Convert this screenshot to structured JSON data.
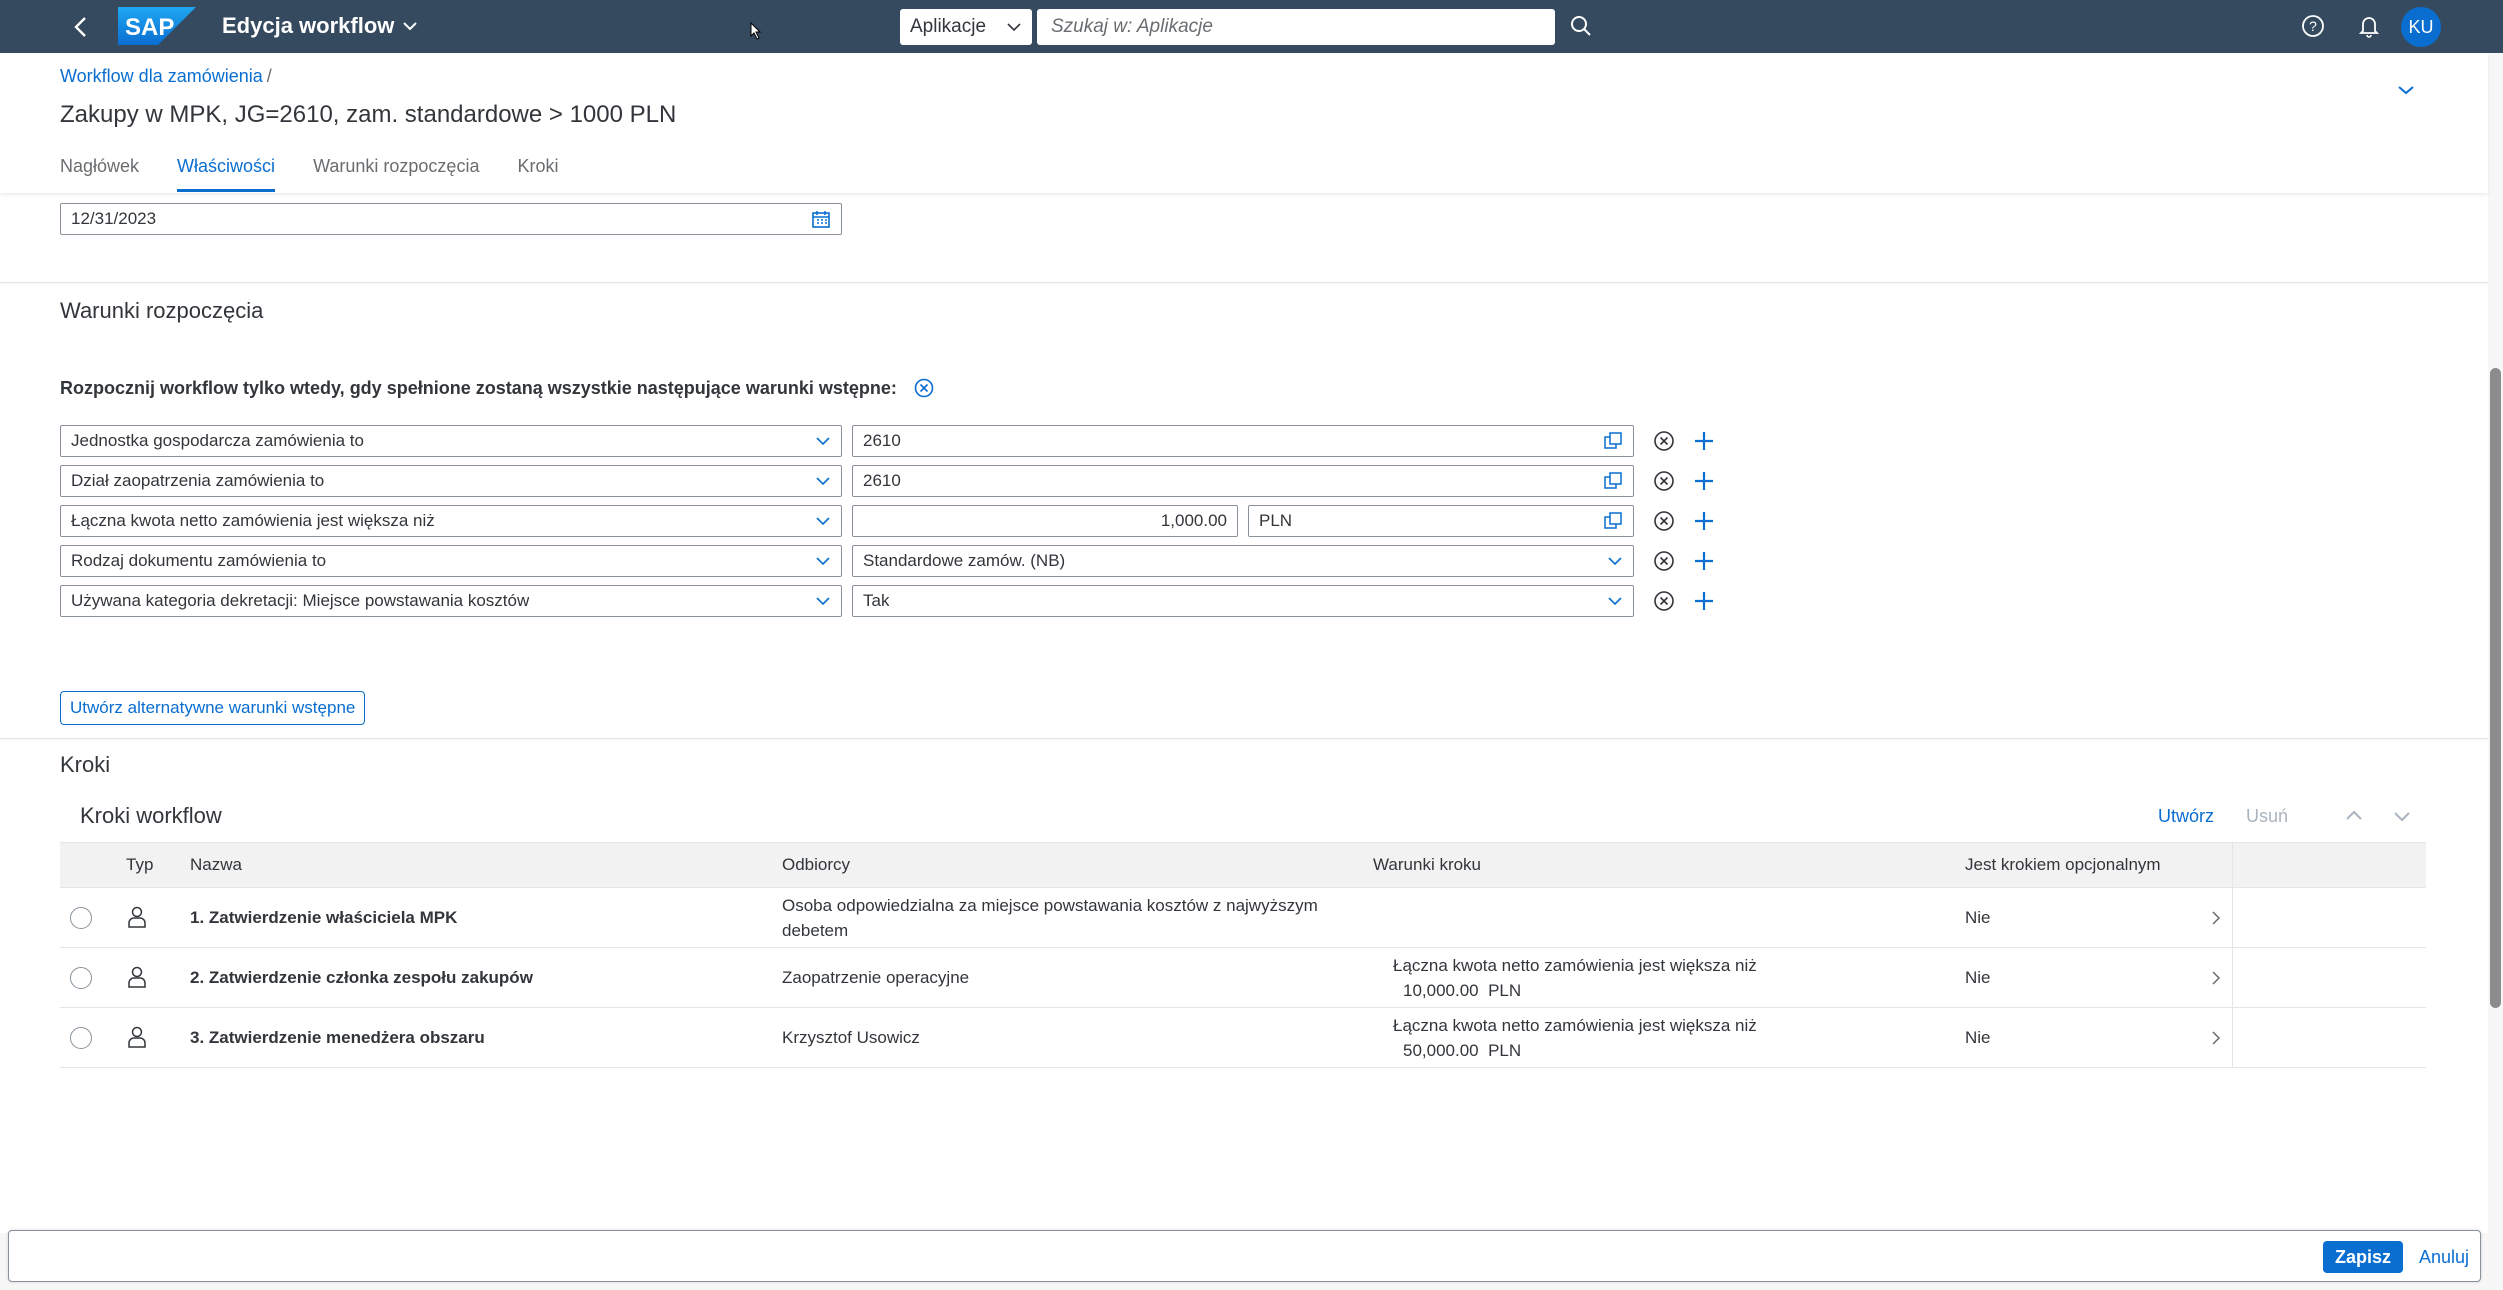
{
  "shell": {
    "app_title": "Edycja workflow",
    "scope": "Aplikacje",
    "search_placeholder": "Szukaj w: Aplikacje",
    "avatar": "KU",
    "logo_text": "SAP"
  },
  "header": {
    "breadcrumb": "Workflow dla zamówienia",
    "breadcrumb_sep": "/",
    "title": "Zakupy w MPK, JG=2610, zam. standardowe > 1000 PLN",
    "tabs": [
      "Nagłówek",
      "Właściwości",
      "Warunki rozpoczęcia",
      "Kroki"
    ],
    "active_tab": "Właściwości"
  },
  "properties": {
    "valid_to": "12/31/2023"
  },
  "start_conditions": {
    "title": "Warunki rozpoczęcia",
    "intro": "Rozpocznij workflow tylko wtedy, gdy spełnione zostaną wszystkie następujące warunki wstępne:",
    "rows": [
      {
        "condition": "Jednostka gospodarcza zamówienia to",
        "value": "2610"
      },
      {
        "condition": "Dział zaopatrzenia zamówienia to",
        "value": "2610"
      },
      {
        "condition": "Łączna kwota netto zamówienia jest większa niż",
        "amount": "1,000.00",
        "currency": "PLN"
      },
      {
        "condition": "Rodzaj dokumentu zamówienia to",
        "value": "Standardowe zamów. (NB)"
      },
      {
        "condition": "Używana kategoria dekretacji: Miejsce powstawania kosztów",
        "value": "Tak"
      }
    ],
    "alt_button": "Utwórz alternatywne warunki wstępne"
  },
  "steps": {
    "section_title": "Kroki",
    "table_title": "Kroki workflow",
    "create": "Utwórz",
    "delete": "Usuń",
    "columns": [
      "Typ",
      "Nazwa",
      "Odbiorcy",
      "Warunki kroku",
      "Jest krokiem opcjonalnym"
    ],
    "rows": [
      {
        "name": "1. Zatwierdzenie właściciela MPK",
        "recipients_l1": "Osoba odpowiedzialna za miejsce powstawania kosztów z najwyższym",
        "recipients_l2": "debetem",
        "cond_l1": "",
        "cond_l2": "",
        "optional": "Nie"
      },
      {
        "name": "2. Zatwierdzenie członka zespołu zakupów",
        "recipients_l1": "Zaopatrzenie operacyjne",
        "recipients_l2": "",
        "cond_l1": "Łączna kwota netto zamówienia jest większa niż",
        "cond_l2": "10,000.00  PLN",
        "optional": "Nie"
      },
      {
        "name": "3. Zatwierdzenie menedżera obszaru",
        "recipients_l1": "Krzysztof Usowicz",
        "recipients_l2": "",
        "cond_l1": "Łączna kwota netto zamówienia jest większa niż",
        "cond_l2": "50,000.00  PLN",
        "optional": "Nie"
      }
    ]
  },
  "footer": {
    "save": "Zapisz",
    "cancel": "Anuluj"
  },
  "colors": {
    "shell": "#354a5f",
    "accent": "#0a6ed1",
    "text": "#32363a"
  }
}
